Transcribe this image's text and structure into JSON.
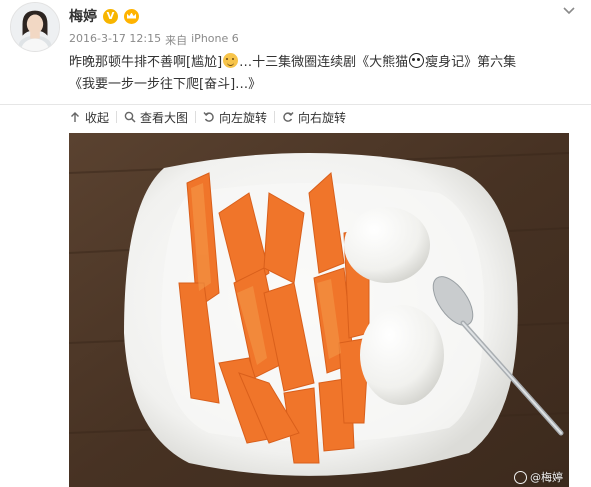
{
  "author": {
    "name": "梅婷",
    "verified_badge": "V",
    "avatar_icon": "avatar-photo",
    "member_icon": "crown-icon"
  },
  "meta": {
    "date": "2016-3-17 12:15",
    "from_label": "来自",
    "device": "iPhone 6"
  },
  "post": {
    "line1_part1": "昨晚那顿牛排不善啊[尴尬]",
    "line1_part2": "…十三集微圈连续剧《大熊猫",
    "line1_part3": "瘦身记》第六集",
    "line2": "《我要一步一步往下爬[奋斗]…》"
  },
  "toolbar": {
    "collapse_label": "收起",
    "view_large_label": "查看大图",
    "rotate_left_label": "向左旋转",
    "rotate_right_label": "向右旋转"
  },
  "photo": {
    "watermark_text": "@梅婷"
  },
  "colors": {
    "verified": "#f7b500",
    "table": "#4b3626",
    "plate": "#f4f4f2",
    "carrot": "#f0752a",
    "egg": "#f6f6f4"
  }
}
